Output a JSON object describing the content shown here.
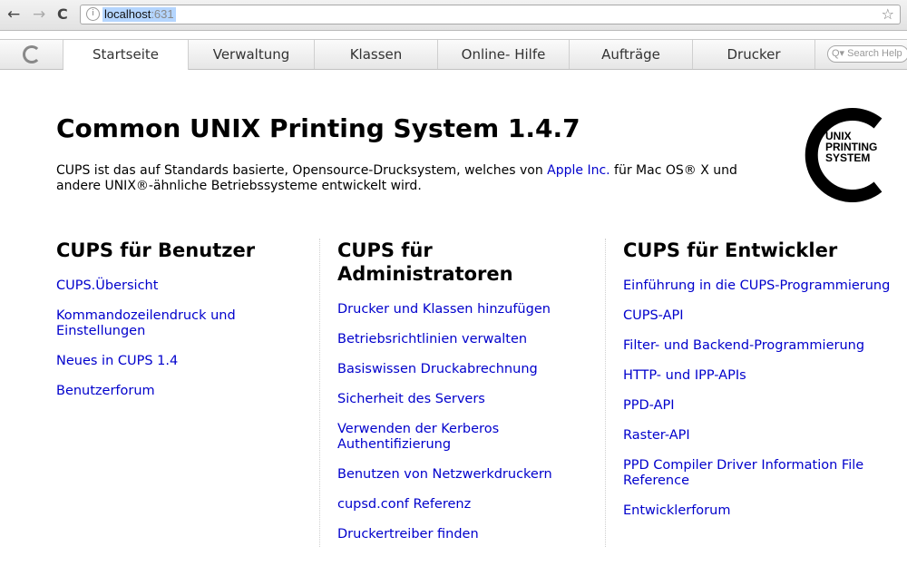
{
  "browser": {
    "back_icon": "←",
    "forward_icon": "→",
    "reload_icon": "C",
    "url_host": "localhost",
    "url_port": ":631",
    "star_icon": "☆"
  },
  "tabs": [
    {
      "label": "Startseite",
      "active": true
    },
    {
      "label": "Verwaltung",
      "active": false
    },
    {
      "label": "Klassen",
      "active": false
    },
    {
      "label": "Online- Hilfe",
      "active": false
    },
    {
      "label": "Aufträge",
      "active": false
    },
    {
      "label": "Drucker",
      "active": false
    }
  ],
  "search": {
    "placeholder": "Q▾ Search Help"
  },
  "main": {
    "title": "Common UNIX Printing System 1.4.7",
    "intro_before": "CUPS ist das auf Standards basierte, Opensource-Drucksystem, welches von ",
    "intro_link": "Apple Inc.",
    "intro_after": " für Mac OS® X und andere UNIX®-ähnliche Betriebssysteme entwickelt wird.",
    "logo_text": [
      "UNIX",
      "PRINTING",
      "SYSTEM"
    ]
  },
  "columns": [
    {
      "heading": "CUPS für Benutzer",
      "links": [
        "CUPS.Übersicht",
        "Kommandozeilendruck und Einstellungen",
        "Neues in CUPS 1.4",
        "Benutzerforum"
      ]
    },
    {
      "heading": "CUPS für Administratoren",
      "links": [
        "Drucker und Klassen hinzufügen",
        "Betriebsrichtlinien verwalten",
        "Basiswissen Druckabrechnung",
        "Sicherheit des Servers",
        "Verwenden der Kerberos Authentifizierung",
        "Benutzen von Netzwerkdruckern",
        "cupsd.conf Referenz",
        "Druckertreiber finden"
      ]
    },
    {
      "heading": "CUPS für Entwickler",
      "links": [
        "Einführung in die CUPS-Programmierung",
        "CUPS-API",
        "Filter- und Backend-Programmierung",
        "HTTP- und IPP-APIs",
        "PPD-API",
        "Raster-API",
        "PPD Compiler Driver Information File Reference",
        "Entwicklerforum"
      ]
    }
  ]
}
